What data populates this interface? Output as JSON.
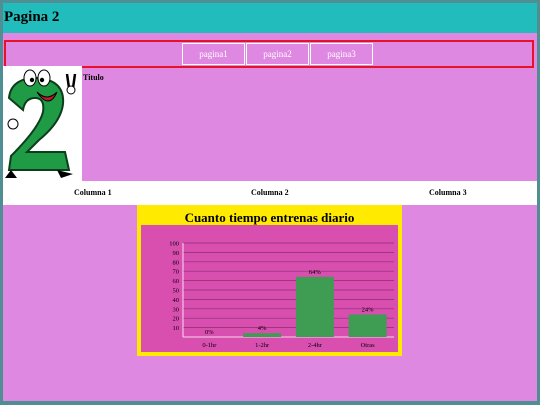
{
  "header": {
    "title": "Pagina 2"
  },
  "nav": {
    "items": [
      "pagina1",
      "pagina2",
      "pagina3"
    ]
  },
  "hero": {
    "title": "Titulo"
  },
  "columns": [
    "Columna 1",
    "Columna 2",
    "Columna 3"
  ],
  "colors": {
    "header_bg": "#22bcbc",
    "page_bg": "#df88e2",
    "nav_border": "#e8112a",
    "chart_frame": "#ffea00",
    "chart_bg": "#d94fb0",
    "bar": "#3e9d52"
  },
  "chart_data": {
    "type": "bar",
    "title": "Cuanto tiempo entrenas diario",
    "categories": [
      "0-1hr",
      "1-2hr",
      "2-4hr",
      "Otras"
    ],
    "values": [
      0,
      4,
      64,
      24
    ],
    "data_labels": [
      "0%",
      "4%",
      "64%",
      "24%"
    ],
    "ylim": [
      0,
      100
    ],
    "yticks": [
      10,
      20,
      30,
      40,
      50,
      60,
      70,
      80,
      90,
      100
    ],
    "grid": true
  }
}
